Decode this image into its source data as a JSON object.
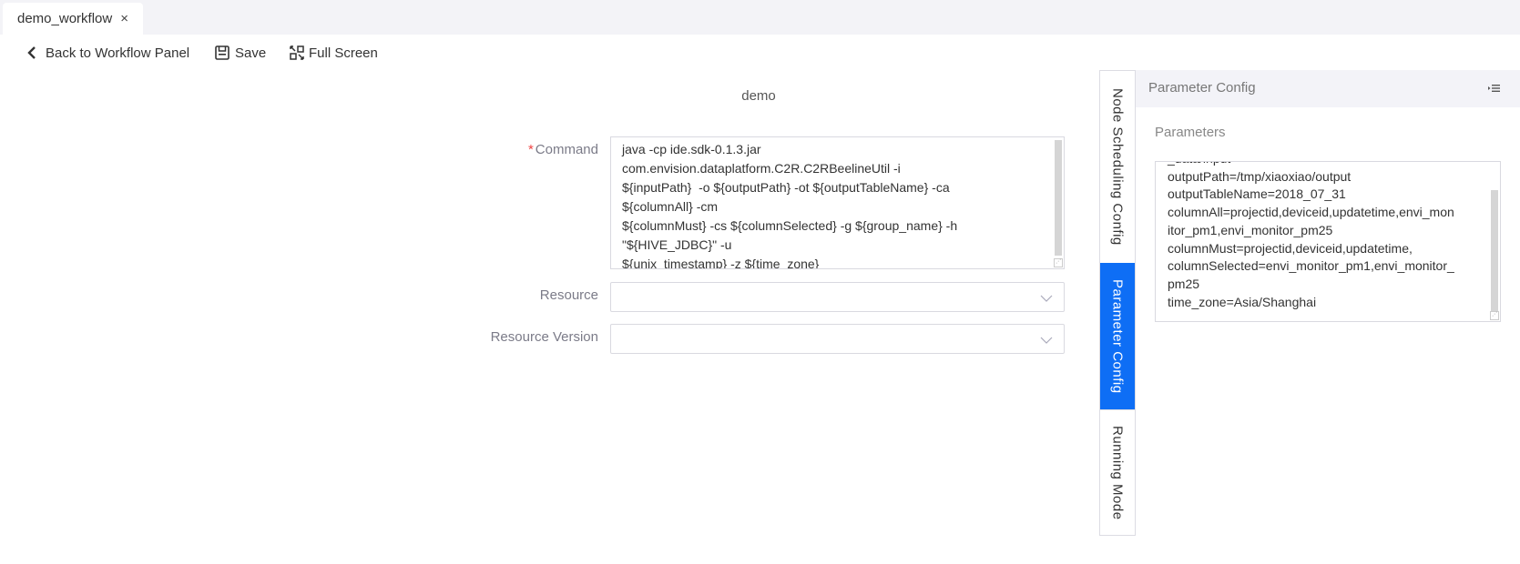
{
  "tabs": [
    {
      "label": "demo_workflow",
      "close_icon": "close-icon",
      "active": true
    }
  ],
  "toolbar": {
    "back_label": "Back to Workflow Panel",
    "save_label": "Save",
    "fullscreen_label": "Full Screen"
  },
  "node": {
    "title": "demo"
  },
  "form": {
    "command": {
      "label": "Command",
      "required_mark": "*",
      "value": "java -cp ide.sdk-0.1.3.jar\ncom.envision.dataplatform.C2R.C2RBeelineUtil -i\n${inputPath}  -o ${outputPath} -ot ${outputTableName} -ca\n${columnAll} -cm\n${columnMust} -cs ${columnSelected} -g ${group_name} -h\n\"${HIVE_JDBC}\" -u\n${unix_timestamp} -z ${time_zone}"
    },
    "resource": {
      "label": "Resource",
      "value": ""
    },
    "resource_version": {
      "label": "Resource Version",
      "value": ""
    }
  },
  "side_tabs": [
    {
      "label": "Node Scheduling Config",
      "active": false
    },
    {
      "label": "Parameter Config",
      "active": true
    },
    {
      "label": "Running Mode",
      "active": false
    }
  ],
  "panel": {
    "title": "Parameter Config",
    "parameters_label": "Parameters",
    "parameters_value": "_data/input\noutputPath=/tmp/xiaoxiao/output\noutputTableName=2018_07_31\ncolumnAll=projectid,deviceid,updatetime,envi_mon\nitor_pm1,envi_monitor_pm25\ncolumnMust=projectid,deviceid,updatetime,\ncolumnSelected=envi_monitor_pm1,envi_monitor_\npm25\ntime_zone=Asia/Shanghai"
  },
  "colors": {
    "accent": "#0e6ef5",
    "required": "#f04545",
    "header_bg": "#f3f3f8"
  }
}
